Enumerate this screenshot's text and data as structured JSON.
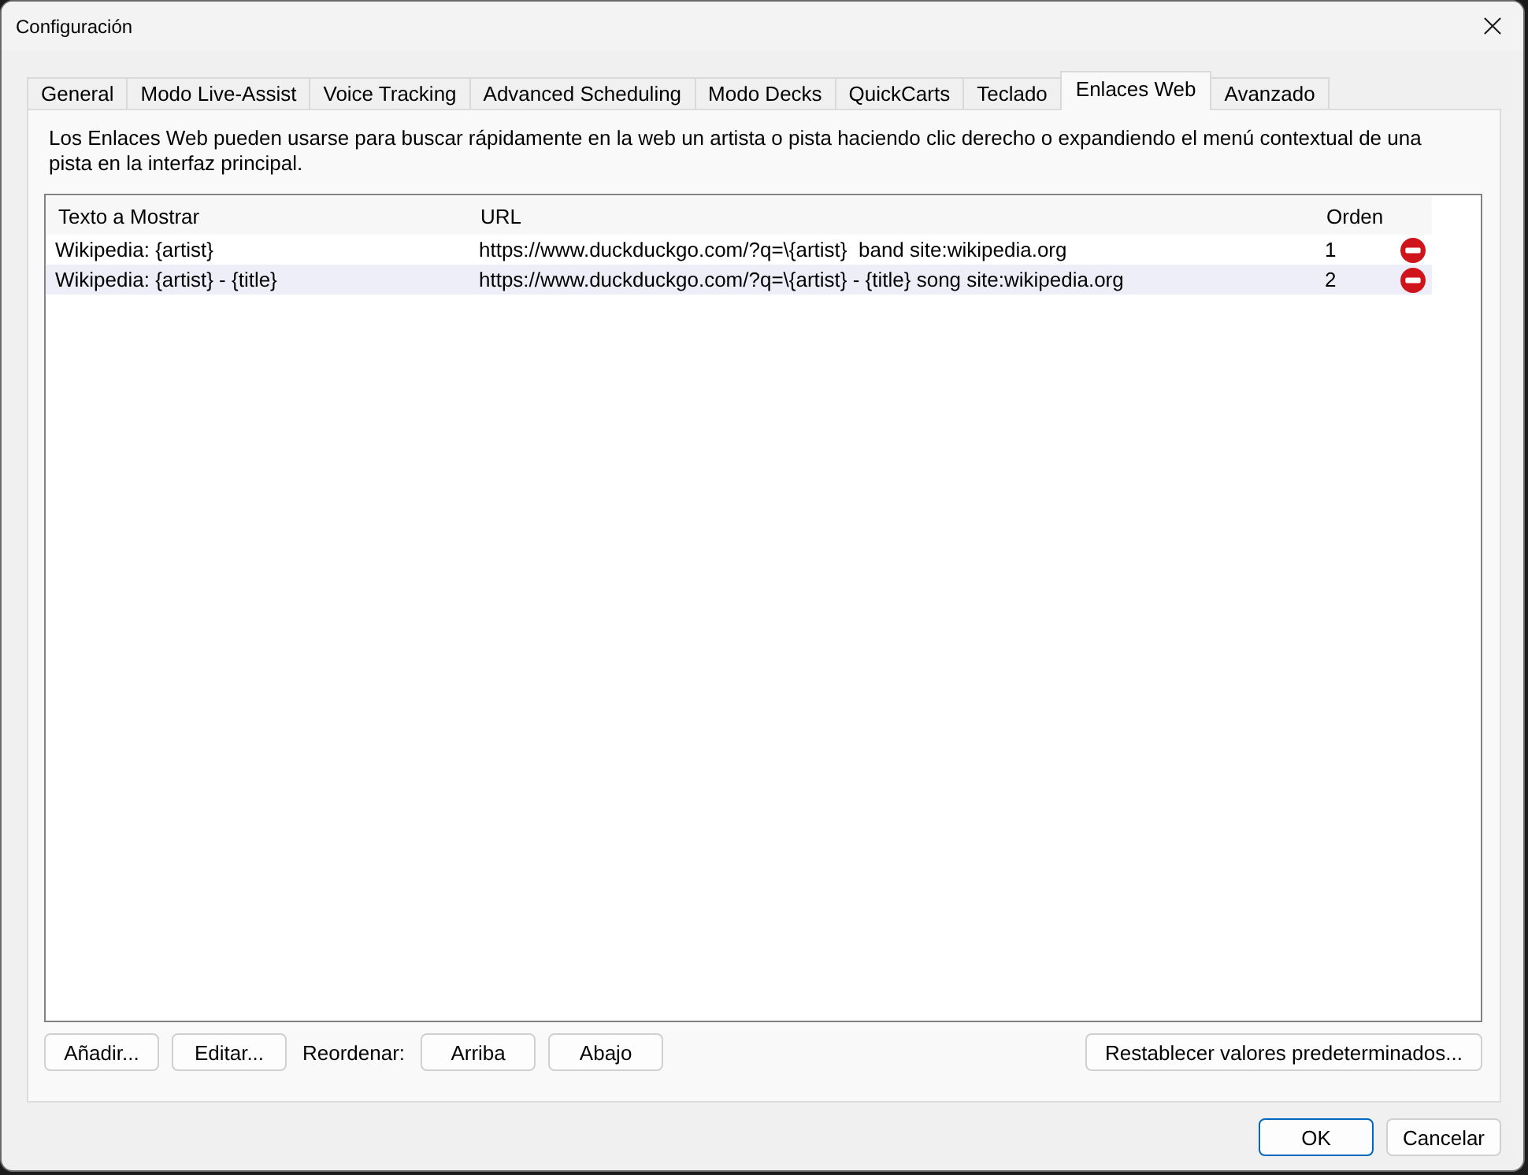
{
  "window": {
    "title": "Configuración"
  },
  "tabs": [
    {
      "label": "General",
      "selected": false
    },
    {
      "label": "Modo Live-Assist",
      "selected": false
    },
    {
      "label": "Voice Tracking",
      "selected": false
    },
    {
      "label": "Advanced Scheduling",
      "selected": false
    },
    {
      "label": "Modo Decks",
      "selected": false
    },
    {
      "label": "QuickCarts",
      "selected": false
    },
    {
      "label": "Teclado",
      "selected": false
    },
    {
      "label": "Enlaces Web",
      "selected": true
    },
    {
      "label": "Avanzado",
      "selected": false
    }
  ],
  "description": "Los Enlaces Web pueden usarse para buscar rápidamente en la web un artista o pista haciendo clic derecho o expandiendo el menú contextual de una pista en la interfaz principal.",
  "table": {
    "columns": [
      "Texto a Mostrar",
      "URL",
      "Orden"
    ],
    "rows": [
      {
        "cells": [
          "Wikipedia: {artist}",
          "https://www.duckduckgo.com/?q=\\{artist}  band site:wikipedia.org",
          "1"
        ],
        "selected": false
      },
      {
        "cells": [
          "Wikipedia: {artist} - {title}",
          "https://www.duckduckgo.com/?q=\\{artist} - {title} song site:wikipedia.org",
          "2"
        ],
        "selected": true
      }
    ]
  },
  "list_actions": [
    {
      "kind": "button",
      "label": "Añadir..."
    },
    {
      "kind": "button",
      "label": "Editar..."
    },
    {
      "kind": "label",
      "label": "Reordenar:"
    },
    {
      "kind": "button",
      "label": "Arriba"
    },
    {
      "kind": "button",
      "label": "Abajo"
    }
  ],
  "reset_button": "Restablecer valores predeterminados...",
  "dialog_buttons": [
    {
      "label": "OK",
      "default": true
    },
    {
      "label": "Cancelar",
      "default": false
    }
  ]
}
